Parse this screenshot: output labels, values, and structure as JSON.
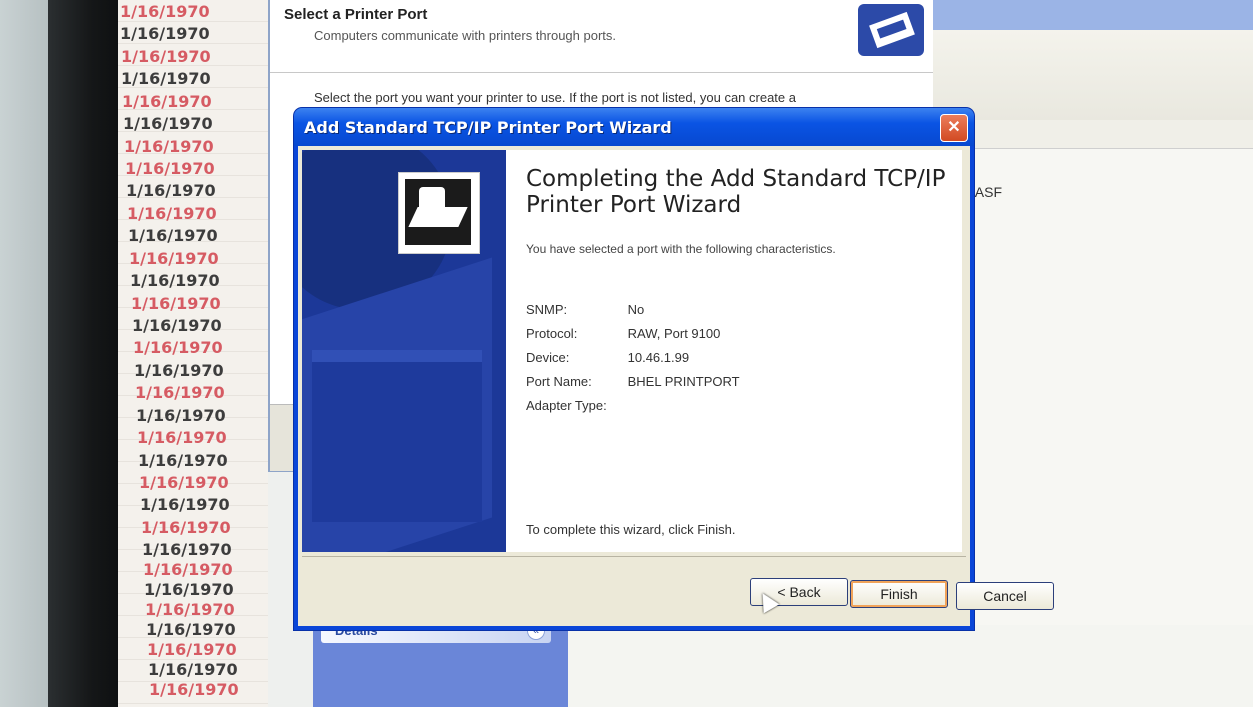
{
  "dates": [
    "1/16/1970",
    "1/16/1970",
    "1/16/1970",
    "1/16/1970",
    "1/16/1970",
    "1/16/1970",
    "1/16/1970",
    "1/16/1970",
    "1/16/1970",
    "1/16/1970",
    "1/16/1970",
    "1/16/1970",
    "1/16/1970",
    "1/16/1970",
    "1/16/1970",
    "1/16/1970",
    "1/16/1970",
    "1/16/1970",
    "1/16/1970",
    "1/16/1970",
    "1/16/1970",
    "1/16/1970",
    "1/16/1970",
    "1/16/1970",
    "1/16/1970",
    "1/16/1970",
    "1/16/1970",
    "1/16/1970",
    "1/16/1970",
    "1/16/1970",
    "1/16/1970",
    "1/16/1970"
  ],
  "background_wizard": {
    "title": "Select a Printer Port",
    "subtitle": "Computers communicate with printers through ports.",
    "instruction": "Select the port you want your printer to use.  If the port is not listed, you can create a"
  },
  "right_pane": {
    "fragment": "FASF"
  },
  "details_pane": {
    "label": "Details",
    "chevron": "«"
  },
  "dialog": {
    "title": "Add Standard TCP/IP Printer Port Wizard",
    "close_glyph": "✕",
    "heading": "Completing the Add Standard TCP/IP Printer Port Wizard",
    "intro": "You have selected a port with the following characteristics.",
    "properties": [
      {
        "key": "SNMP:",
        "value": "No"
      },
      {
        "key": "Protocol:",
        "value": "RAW, Port 9100"
      },
      {
        "key": "Device:",
        "value": "10.46.1.99"
      },
      {
        "key": "Port Name:",
        "value": "BHEL PRINTPORT"
      },
      {
        "key": "Adapter Type:",
        "value": ""
      }
    ],
    "finish_note": "To complete this wizard, click Finish.",
    "buttons": {
      "back": "< Back",
      "finish": "Finish",
      "cancel": "Cancel"
    }
  },
  "icons": [
    "printer-icon",
    "wizard-printer-icon",
    "close-icon",
    "chevron-up-icon",
    "mouse-cursor-icon"
  ]
}
